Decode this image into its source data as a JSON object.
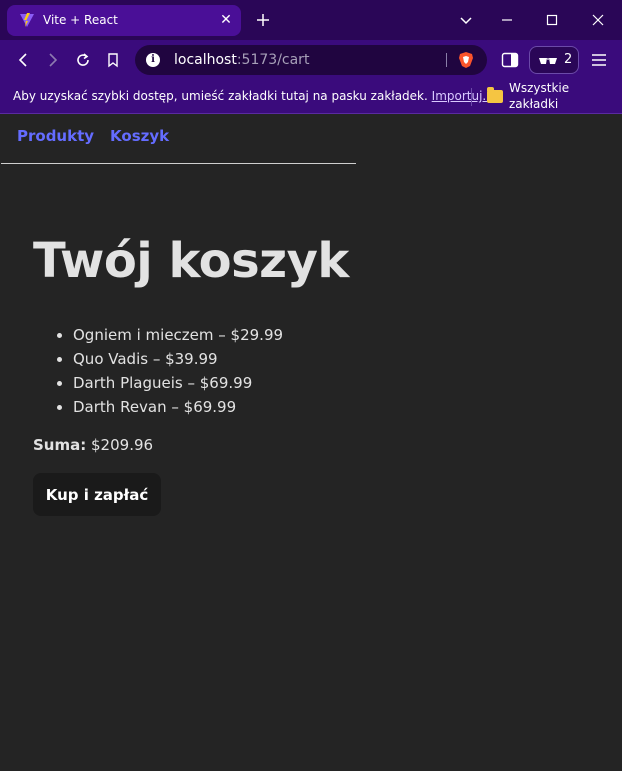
{
  "browser": {
    "tab_title": "Vite + React",
    "tab_close": "✕",
    "url_host": "localhost",
    "url_path": ":5173/cart",
    "extension_count": "2",
    "bookmarks_hint": "Aby uzyskać szybki dostęp, umieść zakładki tutaj na pasku zakładek.",
    "bookmarks_import": "Importuj...",
    "bookmarks_folder": "Wszystkie zakładki",
    "accent_color": "#3a0b7c"
  },
  "nav": {
    "products": "Produkty",
    "cart": "Koszyk",
    "link_color": "#646cff"
  },
  "cart": {
    "title": "Twój koszyk",
    "items": [
      "Ogniem i mieczem – $29.99",
      "Quo Vadis – $39.99",
      "Darth Plagueis – $69.99",
      "Darth Revan – $69.99"
    ],
    "sum_label": "Suma:",
    "sum_value": "$209.96",
    "buy_label": "Kup i zapłać"
  }
}
